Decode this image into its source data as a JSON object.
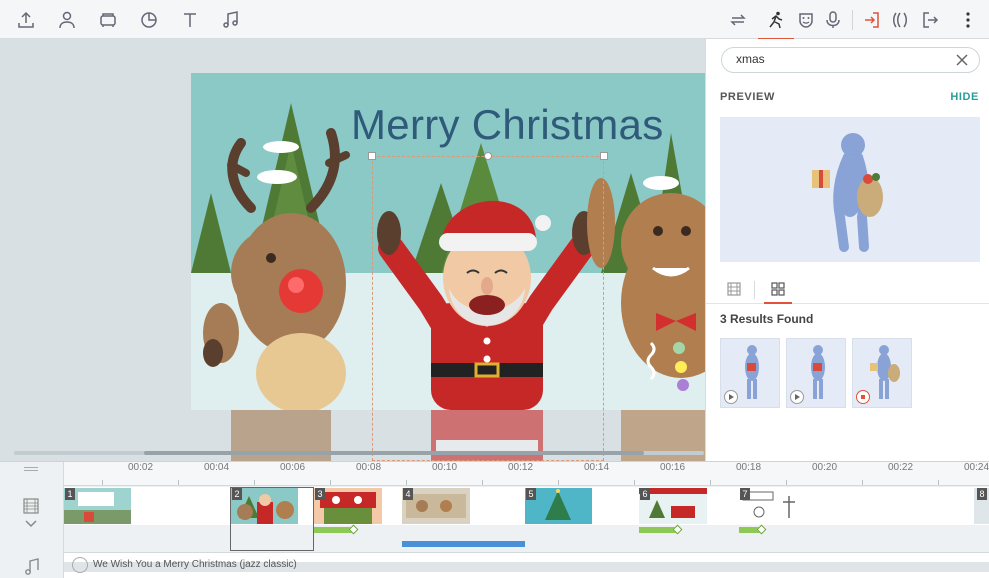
{
  "toolbar": {
    "left_icons": [
      "upload-icon",
      "character-icon",
      "props-icon",
      "chart-icon",
      "text-icon",
      "music-icon"
    ],
    "right_icons": [
      "swap-icon",
      "actions-icon",
      "expression-icon",
      "microphone-icon",
      "enter-effect-icon",
      "motion-path-icon",
      "exit-effect-icon",
      "more-menu-icon"
    ],
    "accent": "#e0523c"
  },
  "canvas": {
    "title": "Merry Christmas",
    "title_color": "#2f5a7a",
    "sky_color": "#8bc9c6"
  },
  "panel": {
    "search_value": "xmas",
    "preview_label": "PREVIEW",
    "hide_label": "HIDE",
    "results_label": "3 Results Found",
    "results": [
      {
        "name": "result-1",
        "state": "play"
      },
      {
        "name": "result-2",
        "state": "play"
      },
      {
        "name": "result-3",
        "state": "stop"
      }
    ]
  },
  "timeline": {
    "ticks": [
      "00:02",
      "00:04",
      "00:06",
      "00:08",
      "00:10",
      "00:12",
      "00:14",
      "00:16",
      "00:18",
      "00:20",
      "00:22",
      "00:24"
    ],
    "scenes": [
      "1",
      "2",
      "3",
      "4",
      "5",
      "6",
      "7",
      "8"
    ],
    "audio_title": "We Wish You a Merry Christmas (jazz classic)"
  }
}
